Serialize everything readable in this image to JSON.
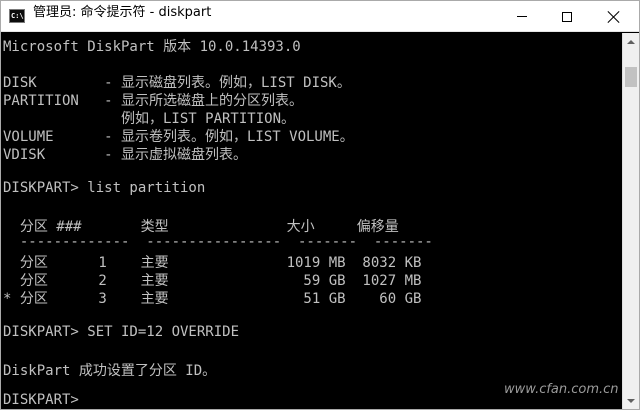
{
  "window": {
    "title": "管理员: 命令提示符 - diskpart",
    "icon": "cmd-icon",
    "icon_text": "C:\\.",
    "controls": {
      "minimize": "minimize-icon",
      "maximize": "maximize-icon",
      "close": "close-icon"
    }
  },
  "console": {
    "lines": [
      "Microsoft DiskPart 版本 10.0.14393.0",
      "",
      "DISK        - 显示磁盘列表。例如，LIST DISK。",
      "PARTITION   - 显示所选磁盘上的分区列表。",
      "              例如，LIST PARTITION。",
      "VOLUME      - 显示卷列表。例如，LIST VOLUME。",
      "VDISK       - 显示虚拟磁盘列表。",
      "",
      "DISKPART> list partition",
      "",
      "  分区 ###       类型              大小     偏移量",
      "  -------------  ----------------  -------  -------",
      "  分区      1    主要              1019 MB  8032 KB",
      "  分区      2    主要                59 GB  1027 MB",
      "* 分区      3    主要                51 GB    60 GB",
      "",
      "DISKPART> SET ID=12 OVERRIDE",
      "",
      "DiskPart 成功设置了分区 ID。",
      "",
      "DISKPART>"
    ]
  },
  "scrollbar": {
    "up": "scroll-up-arrow-icon",
    "down": "scroll-down-arrow-icon"
  },
  "watermark": "www.cfan.com.cn",
  "colors": {
    "console_bg": "#000000",
    "console_text": "#c0c0c0",
    "titlebar_bg": "#ffffff"
  }
}
